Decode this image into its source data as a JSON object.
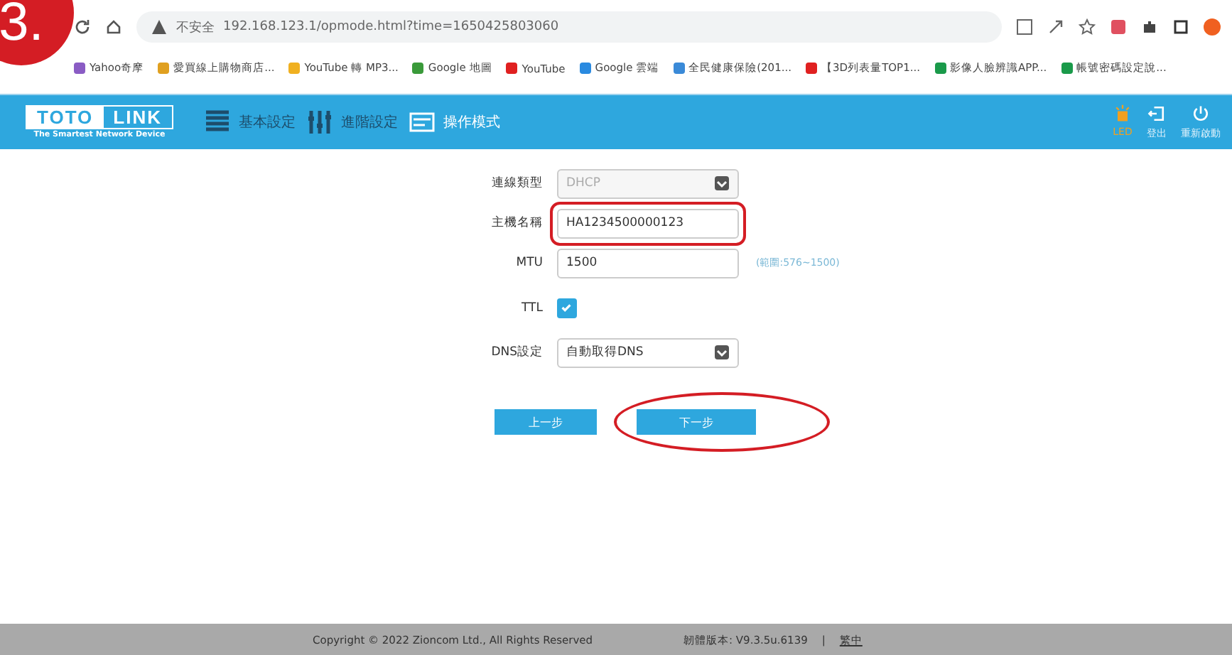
{
  "step_badge": "3.",
  "browser": {
    "security": "不安全",
    "url": "192.168.123.1/opmode.html?time=1650425803060",
    "bookmarks": [
      {
        "label": "Yahoo奇摩",
        "color": "#8a5cc4"
      },
      {
        "label": "愛買線上購物商店...",
        "color": "#e0a020"
      },
      {
        "label": "YouTube 轉 MP3...",
        "color": "#f0b020"
      },
      {
        "label": "Google 地圖",
        "color": "#3a9a3a"
      },
      {
        "label": "YouTube",
        "color": "#e02020"
      },
      {
        "label": "Google 雲端",
        "color": "#2a8ae0"
      },
      {
        "label": "全民健康保險(201...",
        "color": "#3a8ad8"
      },
      {
        "label": "【3D列表量TOP1...",
        "color": "#e02020"
      },
      {
        "label": "影像人臉辨識APP...",
        "color": "#1a9a4a"
      },
      {
        "label": "帳號密碼設定說...",
        "color": "#1a9a4a"
      }
    ]
  },
  "header": {
    "logo_left": "TOTO",
    "logo_right": "LINK",
    "tagline": "The Smartest Network Device",
    "nav": [
      {
        "label": "基本設定",
        "kind": "list",
        "selected": false
      },
      {
        "label": "進階設定",
        "kind": "sliders",
        "selected": false
      },
      {
        "label": "操作模式",
        "kind": "mode",
        "selected": true
      }
    ],
    "actions": [
      {
        "label": "LED",
        "kind": "led",
        "on": true
      },
      {
        "label": "登出",
        "kind": "logout",
        "on": false
      },
      {
        "label": "重新啟動",
        "kind": "power",
        "on": false
      }
    ]
  },
  "form": {
    "rows": [
      {
        "label": "連線類型",
        "kind": "select",
        "value": "DHCP",
        "disabled": true,
        "annotated": false
      },
      {
        "label": "主機名稱",
        "kind": "text",
        "value": "HA1234500000123",
        "annotated": true
      },
      {
        "label": "MTU",
        "kind": "text",
        "value": "1500",
        "hint": "(範圍:576~1500)",
        "annotated": false
      },
      {
        "label": "TTL",
        "kind": "checkbox",
        "checked": true,
        "annotated": false
      },
      {
        "label": "DNS設定",
        "kind": "select",
        "value": "自動取得DNS",
        "disabled": false,
        "annotated": false
      }
    ],
    "buttons": [
      {
        "label": "上一步",
        "annotated": false
      },
      {
        "label": "下一步",
        "annotated": true
      }
    ]
  },
  "footer": {
    "copyright": "Copyright © 2022 Zioncom Ltd., All Rights Reserved",
    "version": "韌體版本: V9.3.5u.6139",
    "separator": "|",
    "language": "繁中"
  }
}
